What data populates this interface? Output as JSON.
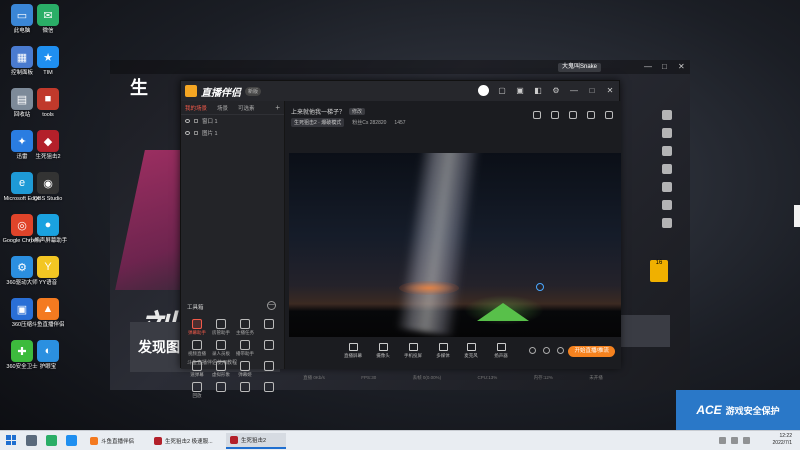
{
  "desktop": {
    "icons": [
      {
        "label": "此电脑",
        "color": "#3a86d6",
        "glyph": "▭"
      },
      {
        "label": "微信",
        "color": "#2aae67",
        "glyph": "✉"
      },
      {
        "label": "控制面板",
        "color": "#4a7bd0",
        "glyph": "▦"
      },
      {
        "label": "TIM",
        "color": "#1f8ff0",
        "glyph": "★"
      },
      {
        "label": "回收站",
        "color": "#7d8a99",
        "glyph": "▤"
      },
      {
        "label": "tools",
        "color": "#c0392b",
        "glyph": "■"
      },
      {
        "label": "迅雷",
        "color": "#2a7de1",
        "glyph": "✦"
      },
      {
        "label": "生死狙击2",
        "color": "#b3202a",
        "glyph": "◆"
      },
      {
        "label": "Microsoft Edge",
        "color": "#1e9ad6",
        "glyph": "e"
      },
      {
        "label": "OBS Studio",
        "color": "#333333",
        "glyph": "◉"
      },
      {
        "label": "Google Chrome",
        "color": "#e0442a",
        "glyph": "◎"
      },
      {
        "label": "小熊声屏幕助手",
        "color": "#1aa2e0",
        "glyph": "●"
      },
      {
        "label": "360驱动大师",
        "color": "#2b8fe0",
        "glyph": "⚙"
      },
      {
        "label": "YY语音",
        "color": "#f3c623",
        "glyph": "Y"
      },
      {
        "label": "360压缩",
        "color": "#2a6fd6",
        "glyph": "▣"
      },
      {
        "label": "斗鱼直播伴侣",
        "color": "#f47a20",
        "glyph": "▲"
      },
      {
        "label": "360安全卫士",
        "color": "#3dbb3d",
        "glyph": "✚"
      },
      {
        "label": "护眼宝",
        "color": "#2b90e0",
        "glyph": "◐"
      }
    ]
  },
  "bg_window": {
    "logo": "生",
    "user_chip": "大鬼叫Snake",
    "big_text": "刘",
    "banner": "发现图",
    "yellow_card": "16"
  },
  "app": {
    "name": "直播伴侣",
    "version_badge": "新版",
    "tabs": [
      "我的场景",
      "场景",
      "可选素"
    ],
    "scenes": [
      {
        "name": "窗口 1"
      },
      {
        "name": "图片 1"
      }
    ],
    "tools_title": "工具箱",
    "tools_collapse": "—",
    "tools": [
      {
        "label": "弹幕助手",
        "red": true
      },
      {
        "label": "房管助手",
        "red": false
      },
      {
        "label": "主播任务",
        "red": false
      },
      {
        "label": "",
        "red": false
      },
      {
        "label": "视频直播",
        "red": false
      },
      {
        "label": "录人员板",
        "red": false
      },
      {
        "label": "播带助手",
        "red": false
      },
      {
        "label": "",
        "red": false
      },
      {
        "label": "速弹幕",
        "red": false
      },
      {
        "label": "虚拟形象",
        "red": false
      },
      {
        "label": "弹幕姬",
        "red": false
      },
      {
        "label": "",
        "red": false
      },
      {
        "label": "回放",
        "red": false
      },
      {
        "label": "",
        "red": false
      },
      {
        "label": "",
        "red": false
      },
      {
        "label": "",
        "red": false
      }
    ],
    "help_link": "斗鱼直播伴侣使用教程",
    "room_title": "上来就他我一梯子？",
    "edit_label": "修改",
    "room_category": "生死狙击2 · 爆破模式",
    "room_fans": "粉丝Cs  282820",
    "room_hot": "1457",
    "bottom_items": [
      "直播屏幕",
      "摄像头",
      "手机投屏",
      "多媒体",
      "麦克风",
      "扬声器"
    ],
    "start_button": "开始直播/推流",
    "status_items": [
      "直播 0Kb/s",
      "FPS:30",
      "丢帧 0(0.00%)",
      "CPU:13%",
      "内存:12%",
      "未开播"
    ]
  },
  "watermark": {
    "logo": "ACE",
    "text": "游戏安全保护"
  },
  "taskbar": {
    "tasks": [
      {
        "label": "斗鱼直播伴侣",
        "color": "#f47a20",
        "active": false
      },
      {
        "label": "生死狙击2 极速服...",
        "color": "#b3202a",
        "active": false
      },
      {
        "label": "生死狙击2",
        "color": "#b3202a",
        "active": true
      }
    ],
    "time": "12:22",
    "date": "2022/7/1"
  }
}
